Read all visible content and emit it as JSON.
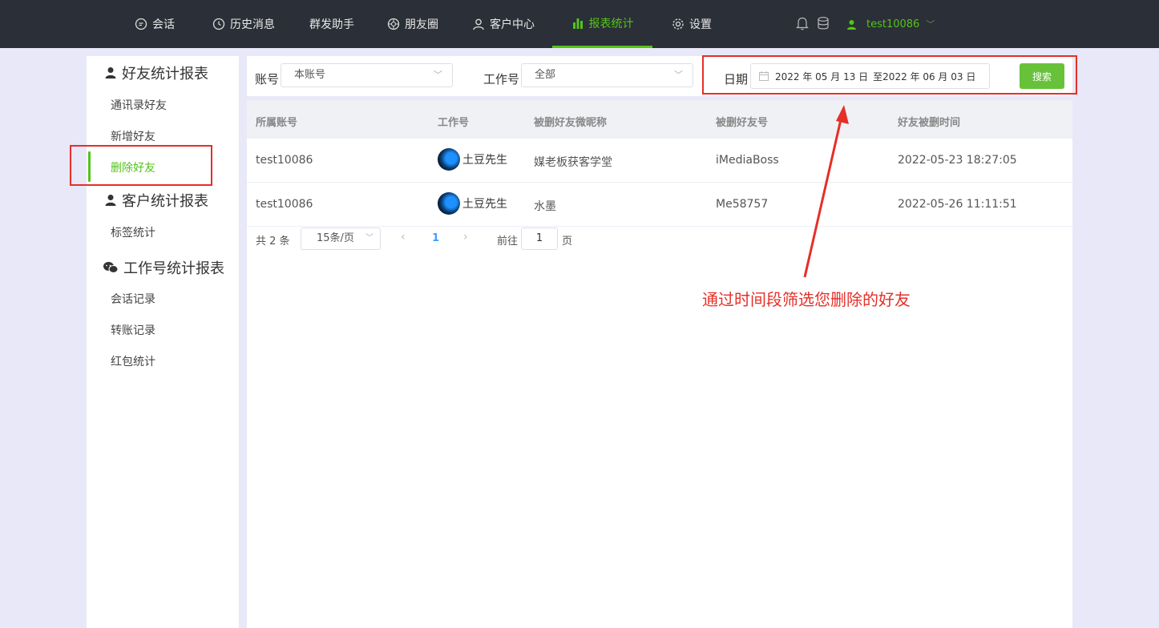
{
  "topnav": {
    "items": [
      {
        "label": "会话"
      },
      {
        "label": "历史消息"
      },
      {
        "label": "群发助手"
      },
      {
        "label": "朋友圈"
      },
      {
        "label": "客户中心"
      },
      {
        "label": "报表统计"
      },
      {
        "label": "设置"
      }
    ],
    "active_index": 5,
    "user": "test10086"
  },
  "sidebar": {
    "group1": {
      "title": "好友统计报表",
      "items": [
        "通讯录好友",
        "新增好友",
        "删除好友"
      ]
    },
    "group2": {
      "title": "客户统计报表",
      "items": [
        "标签统计"
      ]
    },
    "group3": {
      "title": "工作号统计报表",
      "items": [
        "会话记录",
        "转账记录",
        "红包统计"
      ]
    },
    "active_item": "删除好友"
  },
  "filters": {
    "account_label": "账号",
    "account_value": "本账号",
    "worker_label": "工作号",
    "worker_value": "全部",
    "date_label": "日期",
    "date_start": "2022 年 05 月 13 日",
    "date_sep": "至",
    "date_end": "2022 年 06 月 03 日",
    "search_button": "搜索"
  },
  "table": {
    "columns": [
      "所属账号",
      "工作号",
      "被删好友微昵称",
      "被删好友号",
      "好友被删时间"
    ],
    "rows": [
      {
        "account": "test10086",
        "worker": "土豆先生",
        "nickname": "媒老板获客学堂",
        "friend_id": "iMediaBoss",
        "time": "2022-05-23 18:27:05"
      },
      {
        "account": "test10086",
        "worker": "土豆先生",
        "nickname": "水墨",
        "friend_id": "Me58757",
        "time": "2022-05-26 11:11:51"
      }
    ]
  },
  "pagination": {
    "total": "共 2 条",
    "page_size": "15条/页",
    "current_page": "1",
    "goto_label": "前往",
    "goto_value": "1",
    "page_suffix": "页"
  },
  "annotation": {
    "text": "通过时间段筛选您删除的好友",
    "color": "#e52f28"
  },
  "colors": {
    "accent": "#52c41a",
    "topbar": "#2b2f37",
    "annotation_red": "#e52f28"
  }
}
